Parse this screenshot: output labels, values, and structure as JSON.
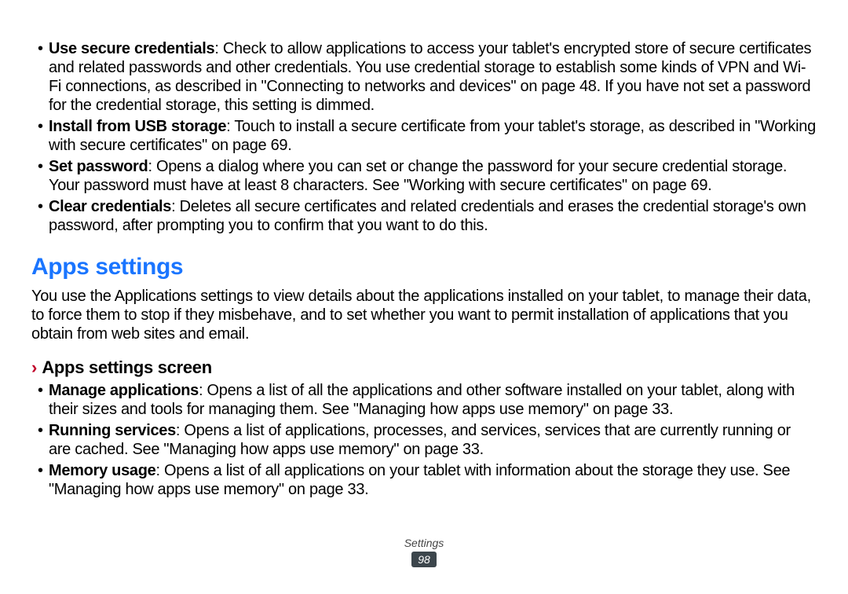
{
  "bullets_top": [
    {
      "term": "Use secure credentials",
      "desc": ": Check to allow applications to access your tablet's encrypted store of secure certificates and related passwords and other credentials. You use credential storage to establish some kinds of VPN and Wi-Fi connections, as described in \"Connecting to networks and devices\" on page 48. If you have not set a password for the credential storage, this setting is dimmed."
    },
    {
      "term": "Install from USB storage",
      "desc": ": Touch to install a secure certificate from your tablet's storage, as described in \"Working with secure certificates\" on page 69."
    },
    {
      "term": "Set password",
      "desc": ": Opens a dialog where you can set or change the password for your secure credential storage. Your password must have at least 8 characters. See \"Working with secure certificates\" on page 69."
    },
    {
      "term": "Clear credentials",
      "desc": ": Deletes all secure certificates and related credentials and erases the credential storage's own password, after prompting you to confirm that you want to do this."
    }
  ],
  "section_heading": "Apps settings",
  "section_para": "You use the Applications settings to view details about the applications installed on your tablet, to manage their data, to force them to stop if they misbehave, and to set whether you want to permit installation of applications that you obtain from web sites and email.",
  "sub_heading": "Apps settings screen",
  "bullets_sub": [
    {
      "term": "Manage applications",
      "desc": ": Opens a list of all the applications and other software installed on your tablet, along with their sizes and tools for managing them. See \"Managing how apps use memory\" on page 33."
    },
    {
      "term": "Running services",
      "desc": ": Opens a list of applications, processes, and services, services that are currently running or are cached. See \"Managing how apps use memory\" on page 33."
    },
    {
      "term": "Memory usage",
      "desc": ": Opens a list of all applications on your tablet with information about the storage they use. See \"Managing how apps use memory\" on page 33."
    }
  ],
  "footer_label": "Settings",
  "page_number": "98",
  "chevron": "›",
  "bullet_dot": "•"
}
